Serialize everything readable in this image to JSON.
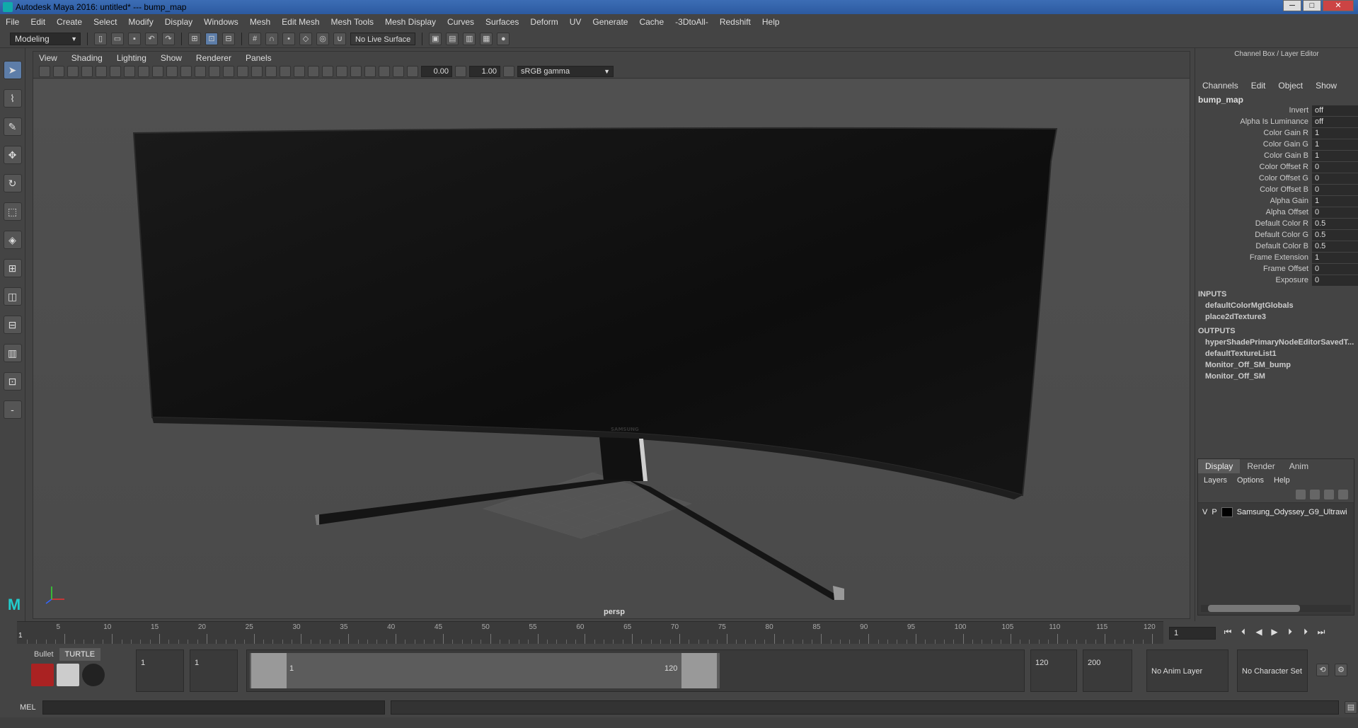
{
  "window": {
    "title": "Autodesk Maya 2016: untitled*    ---    bump_map",
    "minimize": "─",
    "maximize": "□",
    "close": "✕"
  },
  "menubar": [
    "File",
    "Edit",
    "Create",
    "Select",
    "Modify",
    "Display",
    "Windows",
    "Mesh",
    "Edit Mesh",
    "Mesh Tools",
    "Mesh Display",
    "Curves",
    "Surfaces",
    "Deform",
    "UV",
    "Generate",
    "Cache",
    "-3DtoAll-",
    "Redshift",
    "Help"
  ],
  "statusline": {
    "mode": "Modeling",
    "live_surface": "No Live Surface"
  },
  "viewport": {
    "menus": [
      "View",
      "Shading",
      "Lighting",
      "Show",
      "Renderer",
      "Panels"
    ],
    "exposure": "0.00",
    "gamma": "1.00",
    "color_space": "sRGB gamma",
    "camera": "persp",
    "monitor_brand": "SAMSUNG"
  },
  "channelbox": {
    "header": "Channel Box / Layer Editor",
    "menus": [
      "Channels",
      "Edit",
      "Object",
      "Show"
    ],
    "node": "bump_map",
    "attributes": [
      {
        "name": "Invert",
        "value": "off"
      },
      {
        "name": "Alpha Is Luminance",
        "value": "off"
      },
      {
        "name": "Color Gain R",
        "value": "1"
      },
      {
        "name": "Color Gain G",
        "value": "1"
      },
      {
        "name": "Color Gain B",
        "value": "1"
      },
      {
        "name": "Color Offset R",
        "value": "0"
      },
      {
        "name": "Color Offset G",
        "value": "0"
      },
      {
        "name": "Color Offset B",
        "value": "0"
      },
      {
        "name": "Alpha Gain",
        "value": "1"
      },
      {
        "name": "Alpha Offset",
        "value": "0"
      },
      {
        "name": "Default Color R",
        "value": "0.5"
      },
      {
        "name": "Default Color G",
        "value": "0.5"
      },
      {
        "name": "Default Color B",
        "value": "0.5"
      },
      {
        "name": "Frame Extension",
        "value": "1"
      },
      {
        "name": "Frame Offset",
        "value": "0"
      },
      {
        "name": "Exposure",
        "value": "0"
      }
    ],
    "inputs_label": "INPUTS",
    "inputs": [
      "defaultColorMgtGlobals",
      "place2dTexture3"
    ],
    "outputs_label": "OUTPUTS",
    "outputs": [
      "hyperShadePrimaryNodeEditorSavedT...",
      "defaultTextureList1",
      "Monitor_Off_SM_bump",
      "Monitor_Off_SM"
    ]
  },
  "layers": {
    "tabs": [
      "Display",
      "Render",
      "Anim"
    ],
    "menus": [
      "Layers",
      "Options",
      "Help"
    ],
    "row": {
      "v": "V",
      "p": "P",
      "name": "Samsung_Odyssey_G9_Ultrawi"
    }
  },
  "timeline": {
    "ticks": [
      "5",
      "10",
      "15",
      "20",
      "25",
      "30",
      "35",
      "40",
      "45",
      "50",
      "55",
      "60",
      "65",
      "70",
      "75",
      "80",
      "85",
      "90",
      "95",
      "100",
      "105",
      "110",
      "115",
      "120"
    ],
    "current": "1",
    "current_frame_field": "1"
  },
  "range": {
    "shelf_tabs": [
      "Bullet",
      "TURTLE"
    ],
    "start": "1",
    "playback_start": "1",
    "slider_start": "1",
    "slider_end": "120",
    "playback_end": "120",
    "end": "200",
    "anim_layer": "No Anim Layer",
    "character_set": "No Character Set"
  },
  "cmdline": {
    "label": "MEL"
  }
}
